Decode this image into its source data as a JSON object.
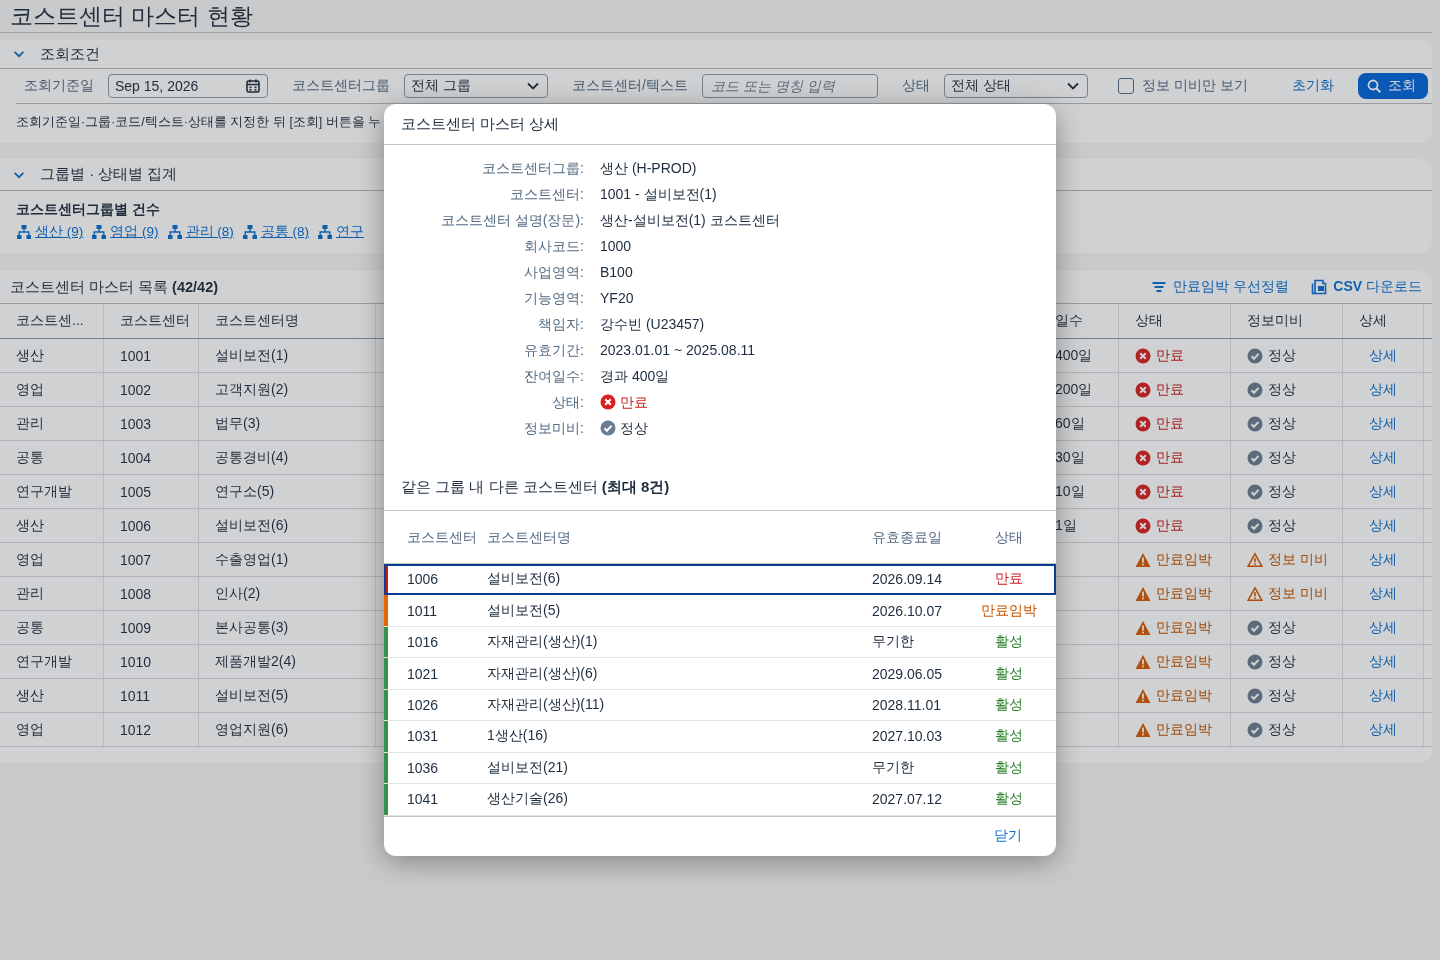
{
  "page": {
    "title": "코스트센터 마스터 현황"
  },
  "filter_panel": {
    "title": "조회조건",
    "expanded": true,
    "fields": [
      {
        "kind": "date",
        "label": "조회기준일",
        "value": "Sep 15, 2026"
      },
      {
        "kind": "select",
        "label": "코스트센터그룹",
        "value": "전체 그룹"
      },
      {
        "kind": "text",
        "label": "코스트센터/텍스트",
        "placeholder": "코드 또는 명칭 입력"
      },
      {
        "kind": "select",
        "label": "상태",
        "value": "전체 상태"
      }
    ],
    "checkbox": {
      "label": "정보 미비만 보기",
      "checked": false
    },
    "reset": "초기화",
    "search": "조회",
    "hint": "조회기준일·그룹·코드/텍스트·상태를 지정한 뒤 [조회] 버튼을 누"
  },
  "summary_panel": {
    "title": "그룹별 · 상태별 집계",
    "expanded": true,
    "subtitle": "코스트센터그룹별 건수",
    "links": [
      "생산 (9)",
      "영업 (9)",
      "관리 (8)",
      "공통 (8)",
      "연구"
    ]
  },
  "list": {
    "title": "코스트센터 마스터 목록 **(42/42)**",
    "actions": [
      {
        "kind": "sort",
        "label": "만료임박 우선정렬"
      },
      {
        "kind": "download",
        "label": "**CSV** 다운로드"
      }
    ],
    "columns": [
      "코스트센...",
      "코스트센터",
      "코스트센터명",
      "일수",
      "상태",
      "정보미비",
      "상세"
    ],
    "rows": [
      {
        "group": "생산",
        "code": "1001",
        "name": "설비보전(1)",
        "days": "400일",
        "status": {
          "kind": "expired",
          "label": "만료"
        },
        "info": {
          "kind": "ok",
          "label": "정상"
        },
        "link": "상세"
      },
      {
        "group": "영업",
        "code": "1002",
        "name": "고객지원(2)",
        "days": "200일",
        "status": {
          "kind": "expired",
          "label": "만료"
        },
        "info": {
          "kind": "ok",
          "label": "정상"
        },
        "link": "상세"
      },
      {
        "group": "관리",
        "code": "1003",
        "name": "법무(3)",
        "days": "60일",
        "status": {
          "kind": "expired",
          "label": "만료"
        },
        "info": {
          "kind": "ok",
          "label": "정상"
        },
        "link": "상세"
      },
      {
        "group": "공통",
        "code": "1004",
        "name": "공통경비(4)",
        "days": "30일",
        "status": {
          "kind": "expired",
          "label": "만료"
        },
        "info": {
          "kind": "ok",
          "label": "정상"
        },
        "link": "상세"
      },
      {
        "group": "연구개발",
        "code": "1005",
        "name": "연구소(5)",
        "days": "10일",
        "status": {
          "kind": "expired",
          "label": "만료"
        },
        "info": {
          "kind": "ok",
          "label": "정상"
        },
        "link": "상세"
      },
      {
        "group": "생산",
        "code": "1006",
        "name": "설비보전(6)",
        "days": "1일",
        "status": {
          "kind": "expired",
          "label": "만료"
        },
        "info": {
          "kind": "ok",
          "label": "정상"
        },
        "link": "상세"
      },
      {
        "group": "영업",
        "code": "1007",
        "name": "수출영업(1)",
        "status": {
          "kind": "expiring",
          "label": "만료임박"
        },
        "info": {
          "kind": "missing",
          "label": "정보 미비"
        },
        "link": "상세"
      },
      {
        "group": "관리",
        "code": "1008",
        "name": "인사(2)",
        "status": {
          "kind": "expiring",
          "label": "만료임박"
        },
        "info": {
          "kind": "missing",
          "label": "정보 미비"
        },
        "link": "상세"
      },
      {
        "group": "공통",
        "code": "1009",
        "name": "본사공통(3)",
        "status": {
          "kind": "expiring",
          "label": "만료임박"
        },
        "info": {
          "kind": "ok",
          "label": "정상"
        },
        "link": "상세"
      },
      {
        "group": "연구개발",
        "code": "1010",
        "name": "제품개발2(4)",
        "status": {
          "kind": "expiring",
          "label": "만료임박"
        },
        "info": {
          "kind": "ok",
          "label": "정상"
        },
        "link": "상세"
      },
      {
        "group": "생산",
        "code": "1011",
        "name": "설비보전(5)",
        "status": {
          "kind": "expiring",
          "label": "만료임박"
        },
        "info": {
          "kind": "ok",
          "label": "정상"
        },
        "link": "상세"
      },
      {
        "group": "영업",
        "code": "1012",
        "name": "영업지원(6)",
        "status": {
          "kind": "expiring",
          "label": "만료임박"
        },
        "info": {
          "kind": "ok",
          "label": "정상"
        },
        "link": "상세"
      }
    ]
  },
  "dialog": {
    "title": "코스트센터 마스터 상세",
    "fields": [
      {
        "kind": "text",
        "label": "코스트센터그룹:",
        "value": "생산 (H-PROD)"
      },
      {
        "kind": "text",
        "label": "코스트센터:",
        "value": "1001 - 설비보전(1)"
      },
      {
        "kind": "text",
        "label": "코스트센터 설명(장문):",
        "value": "생산-설비보전(1) 코스트센터"
      },
      {
        "kind": "text",
        "label": "회사코드:",
        "value": "1000"
      },
      {
        "kind": "text",
        "label": "사업영역:",
        "value": "B100"
      },
      {
        "kind": "text",
        "label": "기능영역:",
        "value": "YF20"
      },
      {
        "kind": "text",
        "label": "책임자:",
        "value": "강수빈 (U23457)"
      },
      {
        "kind": "text",
        "label": "유효기간:",
        "value": "2023.01.01 ~ 2025.08.11"
      },
      {
        "kind": "text",
        "label": "잔여일수:",
        "value": "경과 400일"
      },
      {
        "kind": "status",
        "label": "상태:",
        "value": {
          "kind": "expired",
          "label": "만료"
        }
      },
      {
        "kind": "status",
        "label": "정보미비:",
        "value": {
          "kind": "ok",
          "label": "정상"
        }
      }
    ],
    "related_title": "같은 그룹 내 다른 코스트센터 **(최대 8건)**",
    "related": {
      "columns": [
        "코스트센터",
        "코스트센터명",
        "유효종료일",
        "상태"
      ],
      "rows": [
        {
          "code": "1006",
          "name": "설비보전(6)",
          "end_date": "2026.09.14",
          "status": {
            "kind": "expired",
            "label": "만료"
          },
          "selected": true
        },
        {
          "code": "1011",
          "name": "설비보전(5)",
          "end_date": "2026.10.07",
          "status": {
            "kind": "expiring",
            "label": "만료임박"
          },
          "selected": false
        },
        {
          "code": "1016",
          "name": "자재관리(생산)(1)",
          "end_date": "무기한",
          "status": {
            "kind": "active",
            "label": "활성"
          },
          "selected": false
        },
        {
          "code": "1021",
          "name": "자재관리(생산)(6)",
          "end_date": "2029.06.05",
          "status": {
            "kind": "active",
            "label": "활성"
          },
          "selected": false
        },
        {
          "code": "1026",
          "name": "자재관리(생산)(11)",
          "end_date": "2028.11.01",
          "status": {
            "kind": "active",
            "label": "활성"
          },
          "selected": false
        },
        {
          "code": "1031",
          "name": "1생산(16)",
          "end_date": "2027.10.03",
          "status": {
            "kind": "active",
            "label": "활성"
          },
          "selected": false
        },
        {
          "code": "1036",
          "name": "설비보전(21)",
          "end_date": "무기한",
          "status": {
            "kind": "active",
            "label": "활성"
          },
          "selected": false
        },
        {
          "code": "1041",
          "name": "생산기술(26)",
          "end_date": "2027.07.12",
          "status": {
            "kind": "active",
            "label": "활성"
          },
          "selected": false
        }
      ]
    },
    "close": "닫기"
  }
}
